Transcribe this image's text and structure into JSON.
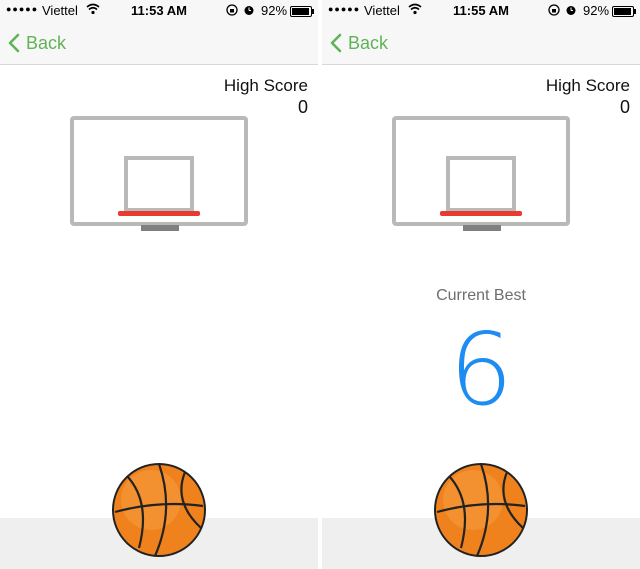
{
  "screens": [
    {
      "status": {
        "signal": "●●●●●",
        "carrier": "Viettel",
        "time": "11:53 AM",
        "battery_pct": "92%",
        "battery_level": 0.92
      },
      "nav": {
        "back_label": "Back"
      },
      "score": {
        "label": "High Score",
        "value": "0"
      },
      "current_best": null
    },
    {
      "status": {
        "signal": "●●●●●",
        "carrier": "Viettel",
        "time": "11:55 AM",
        "battery_pct": "92%",
        "battery_level": 0.92
      },
      "nav": {
        "back_label": "Back"
      },
      "score": {
        "label": "High Score",
        "value": "0"
      },
      "current_best": {
        "label": "Current Best",
        "value": "6"
      }
    }
  ],
  "colors": {
    "accent": "#61b358",
    "score_blue": "#1e8cf0",
    "rim_red": "#e63b2e",
    "backboard_gray": "#b9b9b9",
    "ball_orange": "#f0821e"
  },
  "icons": [
    "back-chevron-icon",
    "wifi-icon",
    "rotation-lock-icon",
    "alarm-icon",
    "battery-icon",
    "basketball-hoop",
    "basketball"
  ]
}
